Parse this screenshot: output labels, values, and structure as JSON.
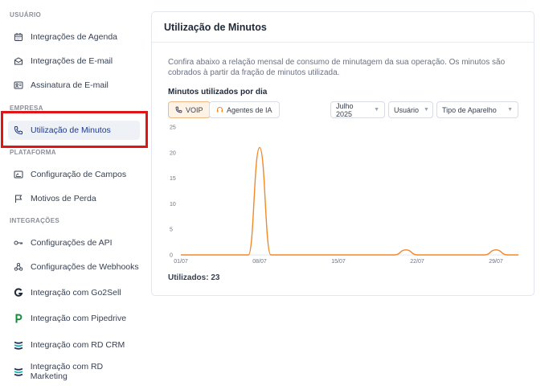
{
  "sidebar": {
    "sections": [
      {
        "label": "USUÁRIO",
        "items": [
          {
            "label": "Integrações de Agenda",
            "icon": "calendar-icon"
          },
          {
            "label": "Integrações de E-mail",
            "icon": "envelope-icon"
          },
          {
            "label": "Assinatura de E-mail",
            "icon": "id-card-icon"
          }
        ]
      },
      {
        "label": "EMPRESA",
        "items": [
          {
            "label": "Utilização de Minutos",
            "icon": "phone-icon",
            "active": true
          }
        ]
      },
      {
        "label": "PLATAFORMA",
        "items": [
          {
            "label": "Configuração de Campos",
            "icon": "form-icon"
          },
          {
            "label": "Motivos de Perda",
            "icon": "flag-icon"
          }
        ]
      },
      {
        "label": "INTEGRAÇÕES",
        "items": [
          {
            "label": "Configurações de API",
            "icon": "key-icon"
          },
          {
            "label": "Configurações de Webhooks",
            "icon": "webhook-icon"
          },
          {
            "label": "Integração com Go2Sell",
            "icon": "go2sell-logo-icon"
          },
          {
            "label": "Integração com Pipedrive",
            "icon": "pipedrive-logo-icon"
          },
          {
            "label": "Integração com RD CRM",
            "icon": "rd-logo-icon"
          },
          {
            "label": "Integração com RD Marketing",
            "icon": "rd-logo-icon"
          }
        ]
      }
    ]
  },
  "panel": {
    "title": "Utilização de Minutos",
    "description": "Confira abaixo a relação mensal de consumo de minutagem da sua operação. Os minutos são cobrados à partir da fração de minutos utilizada.",
    "section_title": "Minutos utilizados por dia",
    "tabs": [
      {
        "label": "VOIP",
        "icon": "phone-icon",
        "active": true
      },
      {
        "label": "Agentes de IA",
        "icon": "headset-icon",
        "active": false
      }
    ],
    "filters": {
      "month": "Julho 2025",
      "user": "Usuário",
      "device": "Tipo de Aparelho"
    },
    "usage_text": "Utilizados: 23"
  },
  "colors": {
    "accent": "#f0892a",
    "active_nav_bg": "#eef1f6",
    "highlight": "#e01515"
  },
  "chart_data": {
    "type": "line",
    "x": [
      "01/07",
      "02/07",
      "03/07",
      "04/07",
      "05/07",
      "06/07",
      "07/07",
      "08/07",
      "09/07",
      "10/07",
      "11/07",
      "12/07",
      "13/07",
      "14/07",
      "15/07",
      "16/07",
      "17/07",
      "18/07",
      "19/07",
      "20/07",
      "21/07",
      "22/07",
      "23/07",
      "24/07",
      "25/07",
      "26/07",
      "27/07",
      "28/07",
      "29/07",
      "30/07",
      "31/07"
    ],
    "values": [
      0,
      0,
      0,
      0,
      0,
      0,
      0,
      21,
      0,
      0,
      0,
      0,
      0,
      0,
      0,
      0,
      0,
      0,
      0,
      0,
      1,
      0,
      0,
      0,
      0,
      0,
      0,
      0,
      1,
      0,
      0
    ],
    "x_ticks": [
      "01/07",
      "08/07",
      "15/07",
      "22/07",
      "29/07"
    ],
    "y_ticks": [
      0,
      5,
      10,
      15,
      20,
      25
    ],
    "ylim": [
      0,
      25
    ],
    "grid": false
  }
}
